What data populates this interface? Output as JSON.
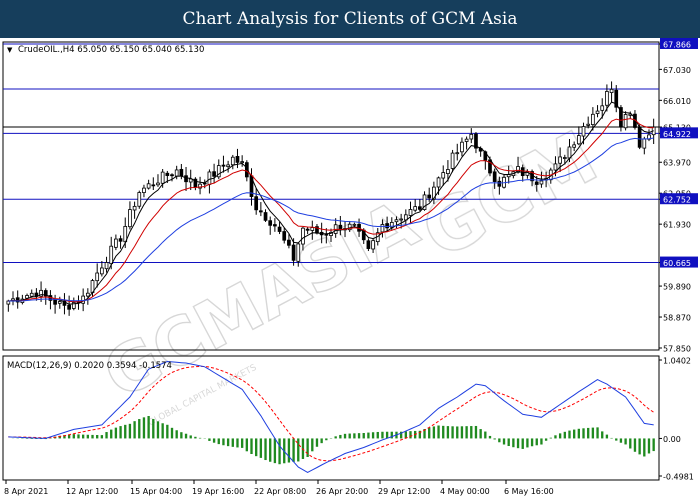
{
  "banner": {
    "title": "Chart Analysis for Clients of GCM Asia"
  },
  "chart_info": {
    "symbol_line": "CrudeOIL.,H4  65.050 65.150 65.040 65.130",
    "arrow_glyph": "▼"
  },
  "macd_info": {
    "label": "MACD(12,26,9) 0.2020 0.3594 -0.1574"
  },
  "watermark": {
    "main": "GCMASIA",
    "sub": "GLOBAL CAPITAL MARKETS",
    "logo_text": "GCM"
  },
  "colors": {
    "banner": "#163e5c",
    "hline": "#1010c0",
    "ema_fast": "#000000",
    "ema_mid": "#d00000",
    "ema_slow": "#2040e0",
    "hist": "#1f8a1f",
    "signal": "#ff0000",
    "macd": "#1f3fe0"
  },
  "chart_data": [
    {
      "type": "candlestick",
      "ylim": [
        57.85,
        67.866
      ],
      "y_ticks": [
        "67.866",
        "67.030",
        "66.010",
        "65.130",
        "64.922",
        "63.970",
        "62.950",
        "62.752",
        "61.930",
        "60.665",
        "59.890",
        "58.870",
        "57.850"
      ],
      "levels": [
        {
          "label": "67.866",
          "value": 67.866,
          "boxed": true
        },
        {
          "label": "66.384",
          "value": 66.384,
          "boxed": true
        },
        {
          "label": "65.130",
          "value": 65.13,
          "boxed": false
        },
        {
          "label": "64.922",
          "value": 64.922,
          "boxed": true
        },
        {
          "label": "62.752",
          "value": 62.752,
          "boxed": true
        },
        {
          "label": "60.665",
          "value": 60.665,
          "boxed": true
        }
      ],
      "x_ticks": [
        "8 Apr 2021",
        "12 Apr 12:00",
        "15 Apr 04:00",
        "19 Apr 16:00",
        "22 Apr 08:00",
        "26 Apr 20:00",
        "29 Apr 12:00",
        "4 May 00:00",
        "6 May 16:00"
      ],
      "close_anchors": [
        [
          0,
          59.4
        ],
        [
          6,
          59.7
        ],
        [
          12,
          59.2
        ],
        [
          16,
          59.5
        ],
        [
          20,
          60.6
        ],
        [
          24,
          61.5
        ],
        [
          28,
          63.0
        ],
        [
          32,
          63.4
        ],
        [
          36,
          63.7
        ],
        [
          40,
          63.2
        ],
        [
          44,
          63.6
        ],
        [
          48,
          64.1
        ],
        [
          50,
          63.9
        ],
        [
          53,
          62.5
        ],
        [
          57,
          61.9
        ],
        [
          61,
          60.8
        ],
        [
          63,
          61.8
        ],
        [
          67,
          61.6
        ],
        [
          71,
          61.9
        ],
        [
          74,
          61.8
        ],
        [
          77,
          61.0
        ],
        [
          80,
          61.9
        ],
        [
          84,
          62.2
        ],
        [
          88,
          62.5
        ],
        [
          91,
          63.2
        ],
        [
          95,
          64.1
        ],
        [
          99,
          64.9
        ],
        [
          102,
          63.9
        ],
        [
          105,
          63.3
        ],
        [
          109,
          63.7
        ],
        [
          113,
          63.4
        ],
        [
          117,
          63.8
        ],
        [
          121,
          64.7
        ],
        [
          125,
          65.6
        ],
        [
          127,
          65.9
        ],
        [
          129,
          66.5
        ],
        [
          131,
          65.3
        ],
        [
          133,
          65.7
        ],
        [
          135,
          64.6
        ],
        [
          137,
          64.9
        ],
        [
          138,
          65.13
        ]
      ]
    },
    {
      "type": "macd",
      "ylim": [
        -0.4981,
        1.0402
      ],
      "y_ticks": [
        "1.0402",
        "0.00",
        "-0.4981"
      ],
      "macd_anchors": [
        [
          0,
          0.02
        ],
        [
          8,
          0.0
        ],
        [
          14,
          0.12
        ],
        [
          20,
          0.18
        ],
        [
          26,
          0.55
        ],
        [
          30,
          0.92
        ],
        [
          34,
          1.02
        ],
        [
          38,
          1.0
        ],
        [
          42,
          0.95
        ],
        [
          46,
          0.8
        ],
        [
          50,
          0.65
        ],
        [
          54,
          0.3
        ],
        [
          58,
          -0.1
        ],
        [
          62,
          -0.38
        ],
        [
          64,
          -0.45
        ],
        [
          68,
          -0.32
        ],
        [
          72,
          -0.2
        ],
        [
          76,
          -0.12
        ],
        [
          80,
          -0.02
        ],
        [
          84,
          0.07
        ],
        [
          88,
          0.18
        ],
        [
          92,
          0.4
        ],
        [
          96,
          0.55
        ],
        [
          100,
          0.72
        ],
        [
          102,
          0.7
        ],
        [
          106,
          0.5
        ],
        [
          110,
          0.32
        ],
        [
          114,
          0.28
        ],
        [
          118,
          0.45
        ],
        [
          122,
          0.62
        ],
        [
          126,
          0.78
        ],
        [
          128,
          0.72
        ],
        [
          132,
          0.55
        ],
        [
          136,
          0.2
        ],
        [
          138,
          0.18
        ]
      ],
      "signal_smoothing": 0.2
    }
  ]
}
